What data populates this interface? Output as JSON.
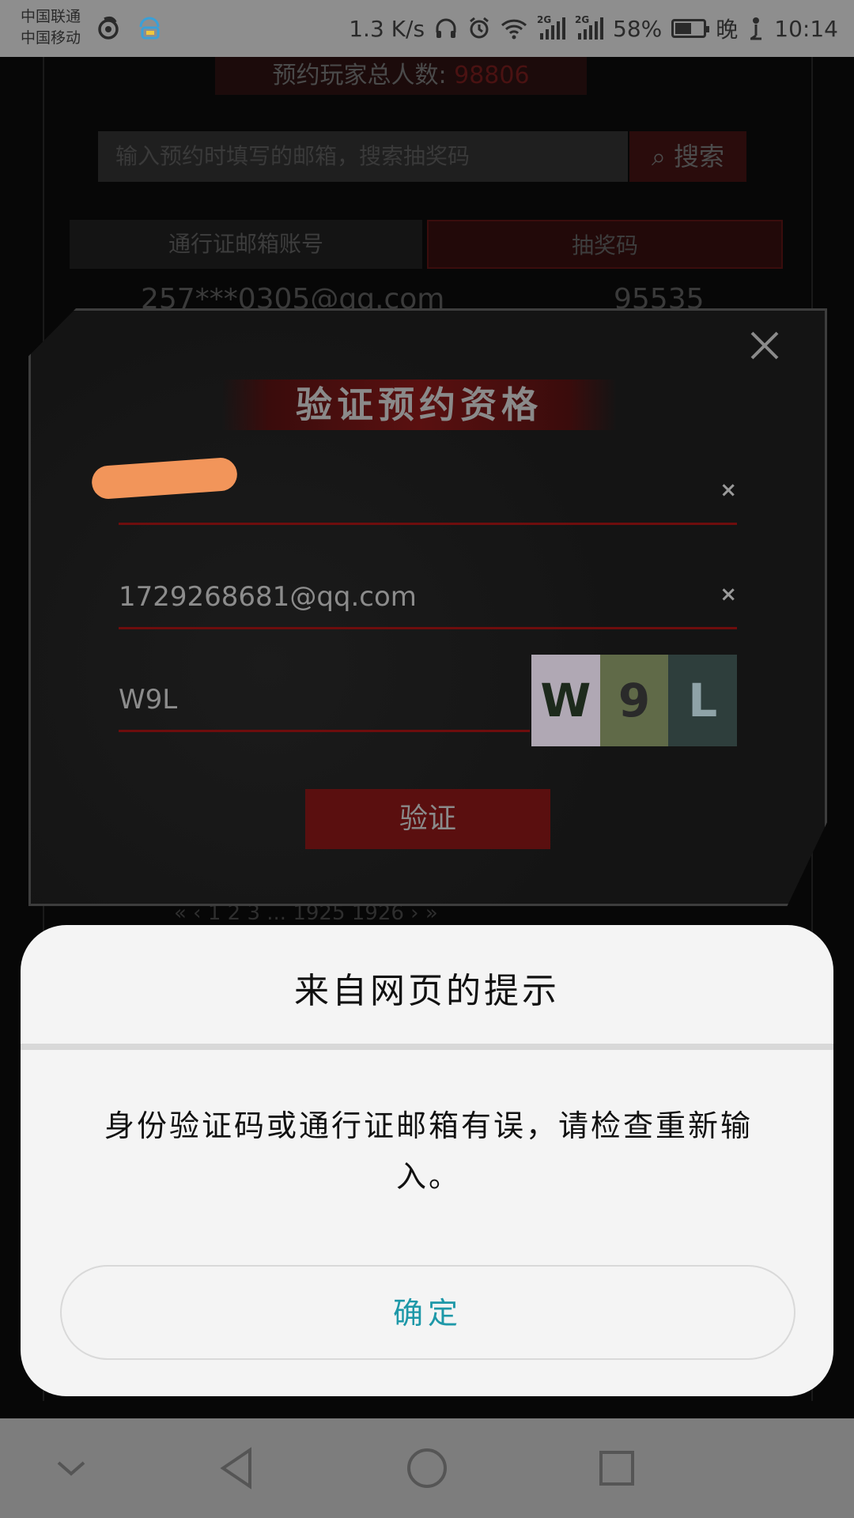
{
  "status_bar": {
    "carrier_1": "中国联通",
    "carrier_2": "中国移动",
    "net_speed": "1.3 K/s",
    "signal_1_type": "2G",
    "signal_2_type": "2G",
    "battery_percent": "58%",
    "battery_level": 0.58,
    "time": "10:14",
    "night_label": "晚",
    "colors": {
      "bg": "#8e8e8e",
      "fg": "#2a2a2a",
      "chat_icon": "#f0c83c"
    }
  },
  "background_page": {
    "reserve_count_label": "预约玩家总人数:",
    "reserve_count_value": "98806",
    "search_placeholder": "输入预约时填写的邮箱，搜索抽奖码",
    "search_button": "搜索",
    "table_header_email": "通行证邮箱账号",
    "table_header_code": "抽奖码",
    "row_email": "257***0305@qq.com",
    "row_code": "95535",
    "pagination": "« ‹ 1 2 3 ... 1925 1926 › »"
  },
  "verify_modal": {
    "title": "验证预约资格",
    "close_icon": "close-icon",
    "field_1_value": "",
    "field_1_clear": "×",
    "email_value": "1729268681@qq.com",
    "email_clear": "×",
    "captcha_value": "W9L",
    "captcha_chars": [
      "W",
      "9",
      "L"
    ],
    "verify_button": "验证",
    "colors": {
      "accent": "#6e0d0d",
      "panel": "#141414"
    }
  },
  "alert_dialog": {
    "title": "来自网页的提示",
    "message": "身份验证码或通行证邮箱有误，请检查重新输入。",
    "ok_button": "确定",
    "colors": {
      "ok_text": "#1e98a8",
      "bg": "#f4f4f4"
    }
  },
  "nav_bar": {
    "buttons": [
      "chevron-down-icon",
      "back-icon",
      "home-icon",
      "recents-icon"
    ]
  }
}
